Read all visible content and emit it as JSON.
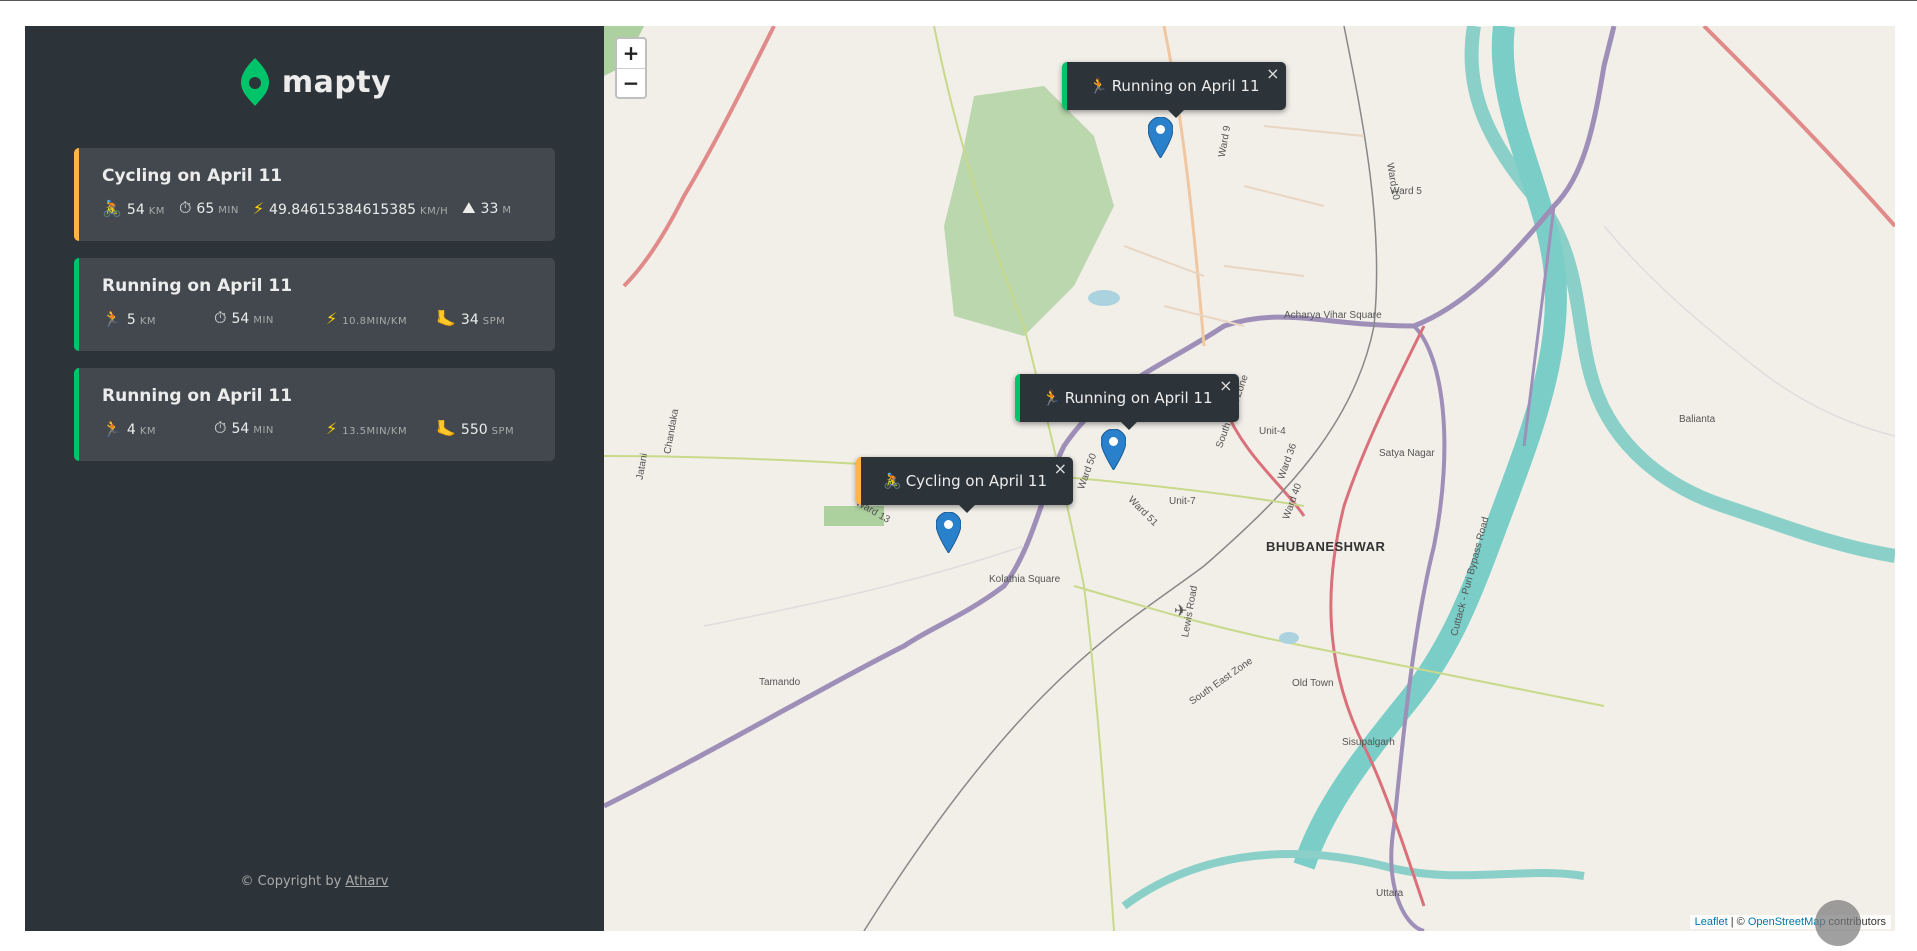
{
  "app": {
    "logo_text": "mapty",
    "brand_color": "#00c46a",
    "cycling_color": "#ffb545",
    "running_color": "#00c46a"
  },
  "workouts": [
    {
      "type": "cycling",
      "title": "Cycling on April 11",
      "distance": {
        "icon": "🚴",
        "value": "54",
        "unit": "km"
      },
      "duration": {
        "icon": "⏱",
        "value": "65",
        "unit": "min"
      },
      "speed": {
        "icon": "⚡",
        "value": "49.84615384615385",
        "unit": "km/h"
      },
      "extra": {
        "icon": "⛰",
        "value": "33",
        "unit": "m"
      }
    },
    {
      "type": "running",
      "title": "Running on April 11",
      "distance": {
        "icon": "🏃",
        "value": "5",
        "unit": "km"
      },
      "duration": {
        "icon": "⏱",
        "value": "54",
        "unit": "min"
      },
      "speed": {
        "icon": "⚡",
        "value": "",
        "unit": "10.8min/km"
      },
      "extra": {
        "icon": "🦶",
        "value": "34",
        "unit": "spm"
      }
    },
    {
      "type": "running",
      "title": "Running on April 11",
      "distance": {
        "icon": "🏃",
        "value": "4",
        "unit": "km"
      },
      "duration": {
        "icon": "⏱",
        "value": "54",
        "unit": "min"
      },
      "speed": {
        "icon": "⚡",
        "value": "",
        "unit": "13.5min/km"
      },
      "extra": {
        "icon": "🦶",
        "value": "550",
        "unit": "spm"
      }
    }
  ],
  "footer": {
    "copyright_prefix": "© Copyright by ",
    "author": "Atharv"
  },
  "map": {
    "zoom_in": "+",
    "zoom_out": "−",
    "popups": [
      {
        "type": "running",
        "icon": "🏃",
        "text": "Running on April 11",
        "close": "×"
      },
      {
        "type": "running",
        "icon": "🏃",
        "text": "Running on April 11",
        "close": "×"
      },
      {
        "type": "cycling",
        "icon": "🚴",
        "text": "Cycling on April 11",
        "close": "×"
      }
    ],
    "city_label": "BHUBANESHWAR",
    "labels": [
      "Acharya Vihar Square",
      "Ward 5",
      "Ward 10",
      "Ward 9",
      "Unit-4",
      "Unit-7",
      "Ward 50",
      "Ward 51",
      "Ward 36",
      "Ward 40",
      "Kolathia Square",
      "Tamando",
      "Jatani",
      "Chandaka",
      "Satya Nagar",
      "Balianta",
      "Old Town",
      "Sisupalgarh",
      "Uttara",
      "Lewis Road",
      "Cuttack - Puri Bypass Road",
      "South East Zone",
      "South West Zone",
      "Ward 13"
    ],
    "attribution": {
      "leaflet": "Leaflet",
      "sep": " | © ",
      "osm": "OpenStreetMap",
      "suffix": " contributors"
    }
  }
}
